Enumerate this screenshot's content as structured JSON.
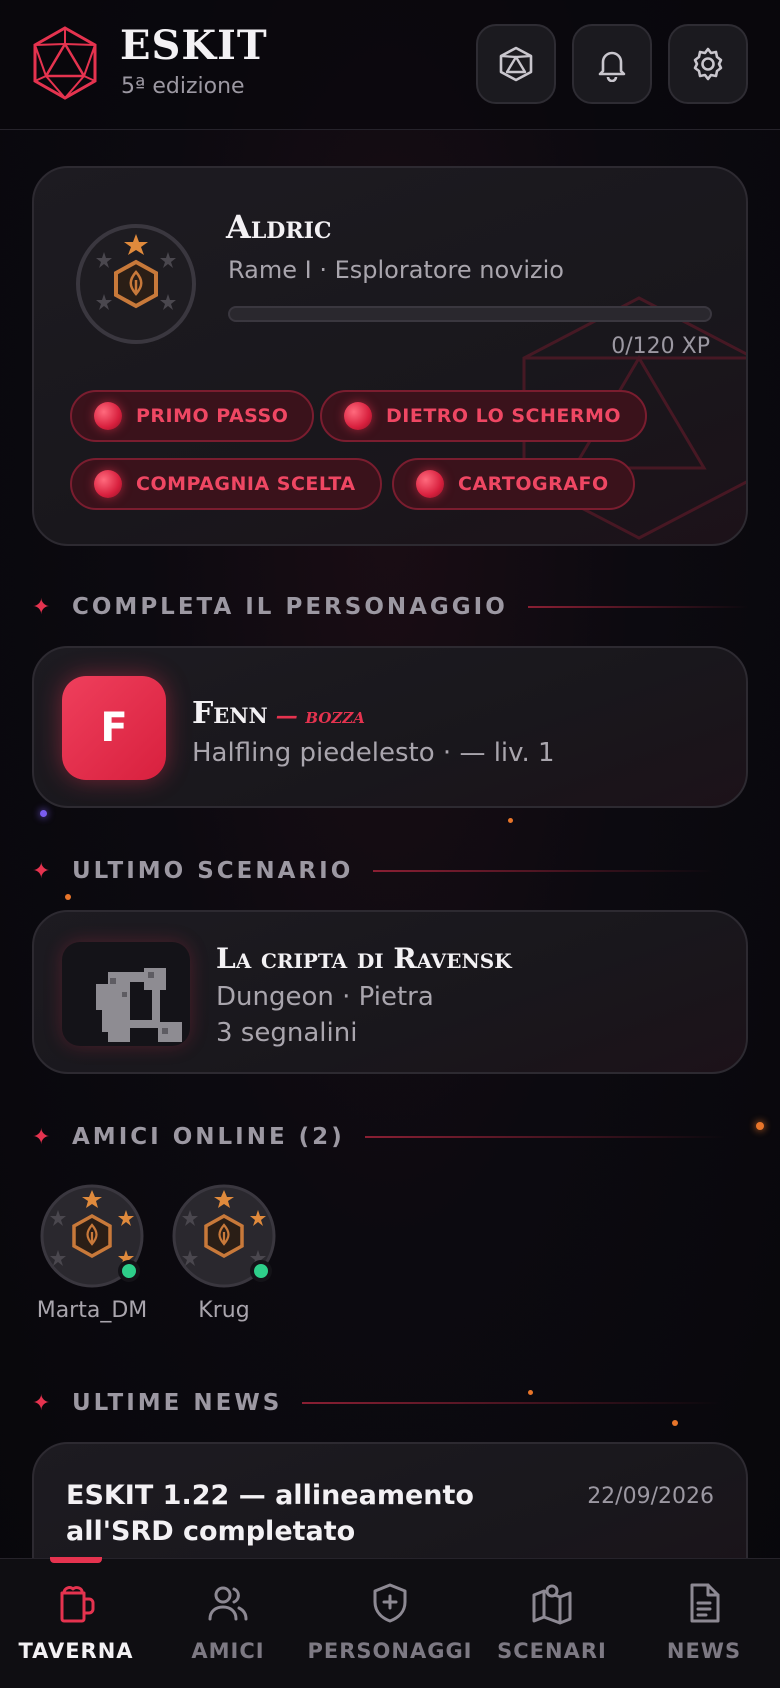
{
  "header": {
    "brand": "ESKIT",
    "edition": "5ª edizione",
    "icons": [
      "dice-icon",
      "bell-icon",
      "gear-icon"
    ]
  },
  "profile": {
    "name": "Aldric",
    "rank": "Rame I · Esploratore novizio",
    "xp_text": "0/120 XP",
    "xp_progress": 0,
    "badges": [
      "PRIMO PASSO",
      "DIETRO LO SCHERMO",
      "COMPAGNIA SCELTA",
      "CARTOGRAFO"
    ]
  },
  "sections": {
    "character": "COMPLETA IL PERSONAGGIO",
    "scenario": "ULTIMO SCENARIO",
    "friends": "AMICI ONLINE (2)",
    "news": "ULTIME NEWS"
  },
  "character": {
    "initial": "F",
    "name": "Fenn",
    "status": "— bozza",
    "subtitle": "Halfling piedelesto · — liv. 1"
  },
  "scenario": {
    "title": "La cripta di Ravensk",
    "subtitle": "Dungeon · Pietra",
    "markers": "3 segnalini"
  },
  "friends": [
    {
      "name": "Marta_DM",
      "online": true
    },
    {
      "name": "Krug",
      "online": true
    }
  ],
  "news": {
    "title": "ESKIT 1.22 — allineamento all'SRD completato",
    "date": "22/09/2026"
  },
  "nav": {
    "items": [
      {
        "label": "TAVERNA",
        "icon": "mug-icon",
        "active": true
      },
      {
        "label": "AMICI",
        "icon": "users-icon",
        "active": false
      },
      {
        "label": "PERSONAGGI",
        "icon": "shield-plus-icon",
        "active": false
      },
      {
        "label": "SCENARI",
        "icon": "map-icon",
        "active": false
      },
      {
        "label": "NEWS",
        "icon": "document-icon",
        "active": false
      }
    ]
  },
  "colors": {
    "accent": "#e5334f",
    "online": "#2ecf8a",
    "rank_copper": "#c8793a"
  }
}
